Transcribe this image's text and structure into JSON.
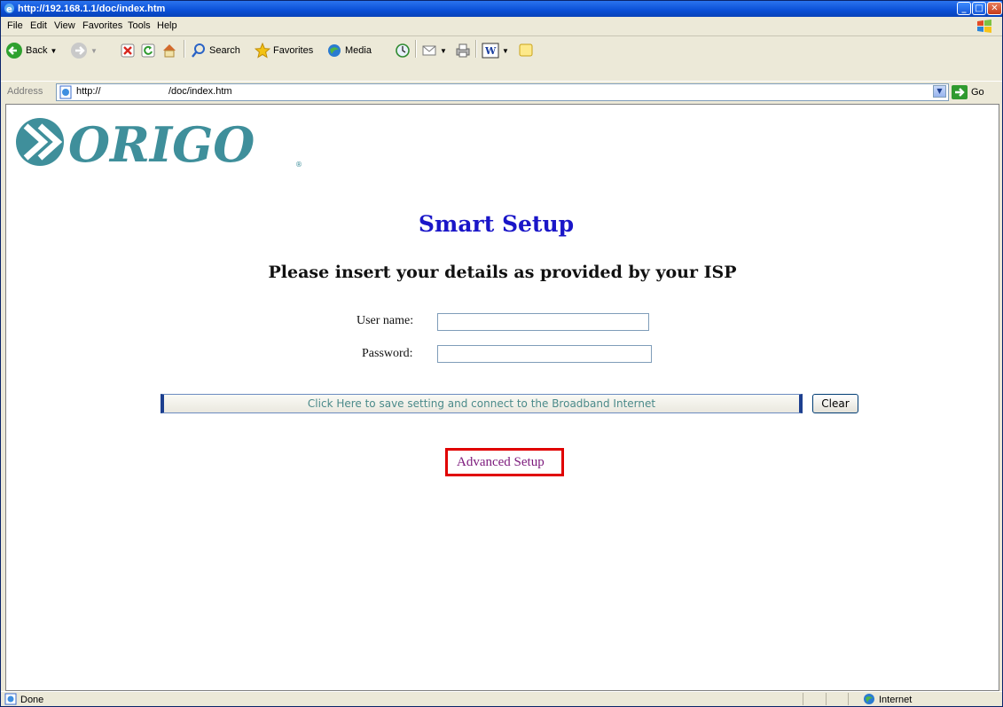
{
  "window": {
    "title": "http://192.168.1.1/doc/index.htm"
  },
  "menu": [
    "File",
    "Edit",
    "View",
    "Favorites",
    "Tools",
    "Help"
  ],
  "toolbar": {
    "back_label": "Back",
    "search_label": "Search",
    "favorites_label": "Favorites",
    "media_label": "Media"
  },
  "address": {
    "label": "Address",
    "url_part1": "http://",
    "url_part2": "/doc/index.htm",
    "go_label": "Go"
  },
  "page": {
    "logo_text": "ORIGO",
    "heading": "Smart Setup",
    "subheading": "Please insert your details as provided by your ISP",
    "username_label": "User name:",
    "password_label": "Password:",
    "connect_button": "Click Here to save setting and connect to the Broadband Internet",
    "clear_button": "Clear",
    "advanced_link": "Advanced Setup"
  },
  "status": {
    "text": "Done",
    "zone": "Internet"
  },
  "colors": {
    "heading": "#1a16c8",
    "link": "#7b187b",
    "highlight": "#e00000",
    "logo": "#3f8f9b"
  }
}
